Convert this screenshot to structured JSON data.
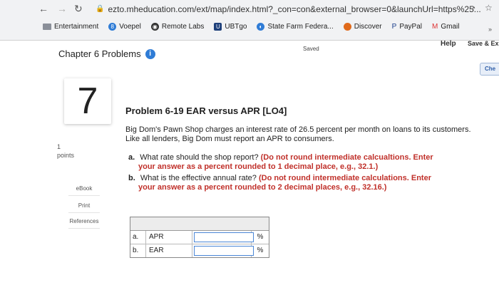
{
  "browser": {
    "url": "ezto.mheducation.com/ext/map/index.html?_con=con&external_browser=0&launchUrl=https%25...",
    "bookmarks": [
      {
        "label": "Entertainment"
      },
      {
        "label": "Voepel"
      },
      {
        "label": "Remote Labs"
      },
      {
        "label": "UBTgo"
      },
      {
        "label": "State Farm Federa..."
      },
      {
        "label": "Discover"
      },
      {
        "label": "PayPal"
      },
      {
        "label": "Gmail"
      }
    ],
    "more": "»"
  },
  "header": {
    "title": "Chapter 6 Problems",
    "saved": "Saved",
    "help": "Help",
    "save_exit": "Save & Ex",
    "check": "Che"
  },
  "rail": {
    "question_number": "7",
    "points_value": "1",
    "points_label": "points",
    "ebook": "eBook",
    "print": "Print",
    "references": "References"
  },
  "problem": {
    "title": "Problem 6-19 EAR versus APR [LO4]",
    "statement": "Big Dom's Pawn Shop charges an interest rate of 26.5 percent per month on loans to its customers. Like all lenders, Big Dom must report an APR to consumers.",
    "qa": {
      "letter": "a.",
      "text": "What rate should the shop report?",
      "instr1": "(Do not round intermediate calcualtions. Enter",
      "instr2": "your answer as a percent rounded to 1 decimal place, e.g., 32.1.)"
    },
    "qb": {
      "letter": "b.",
      "text": "What is the effective annual rate?",
      "instr1": "(Do not round intermediate calculations. Enter",
      "instr2": "your answer as a percent rounded to 2 decimal places, e.g., 32.16.)"
    }
  },
  "answers": {
    "rows": [
      {
        "letter": "a.",
        "label": "APR",
        "value": "",
        "unit": "%"
      },
      {
        "letter": "b.",
        "label": "EAR",
        "value": "",
        "unit": "%"
      }
    ]
  },
  "colors": {
    "accent": "#2f7cd6",
    "instruction": "#c0302a"
  }
}
